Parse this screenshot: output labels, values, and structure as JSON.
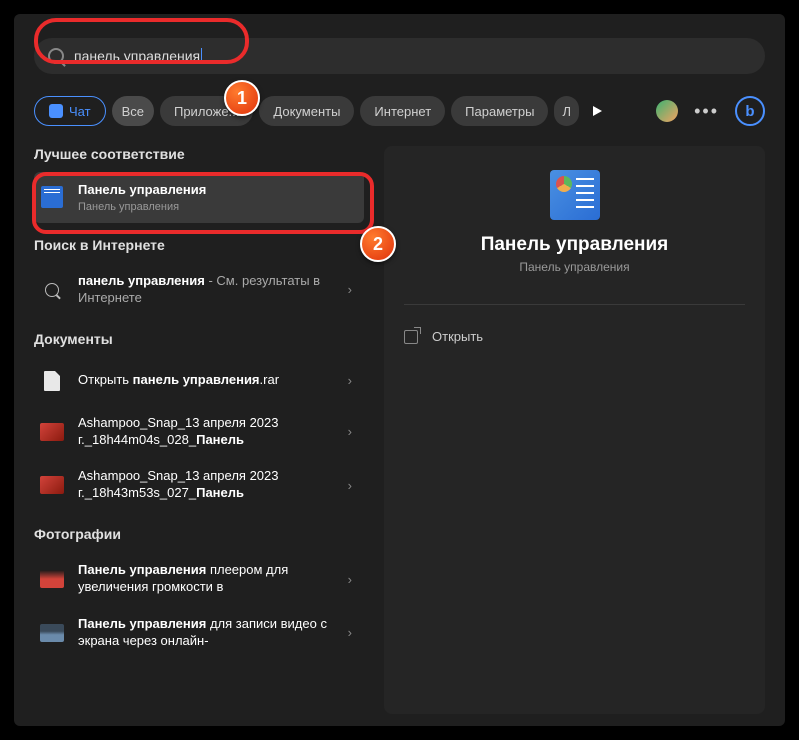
{
  "search": {
    "query": "панель управления"
  },
  "filters": {
    "chat": "Чат",
    "all": "Все",
    "apps": "Приложе...",
    "documents": "Документы",
    "internet": "Интернет",
    "settings": "Параметры",
    "more": "Л"
  },
  "sections": {
    "best_match": "Лучшее соответствие",
    "web_search": "Поиск в Интернете",
    "documents": "Документы",
    "photos": "Фотографии"
  },
  "best_match": {
    "title": "Панель управления",
    "subtitle": "Панель управления"
  },
  "web": {
    "prefix": "панель управления",
    "suffix": " - См. результаты в Интернете"
  },
  "docs": [
    {
      "prefix": "Открыть ",
      "bold": "панель управления",
      "suffix": ".rar"
    },
    {
      "line1": "Ashampoo_Snap_13 апреля 2023",
      "line2_plain": "г._18h44m04s_028_",
      "line2_bold": "Панель"
    },
    {
      "line1": "Ashampoo_Snap_13 апреля 2023",
      "line2_plain": "г._18h43m53s_027_",
      "line2_bold": "Панель"
    }
  ],
  "photos": [
    {
      "bold": "Панель управления",
      "suffix": " плеером для увеличения громкости в"
    },
    {
      "bold": "Панель управления",
      "suffix": " для записи видео с экрана через онлайн-"
    }
  ],
  "details": {
    "title": "Панель управления",
    "subtitle": "Панель управления",
    "open": "Открыть"
  },
  "callouts": {
    "one": "1",
    "two": "2"
  }
}
